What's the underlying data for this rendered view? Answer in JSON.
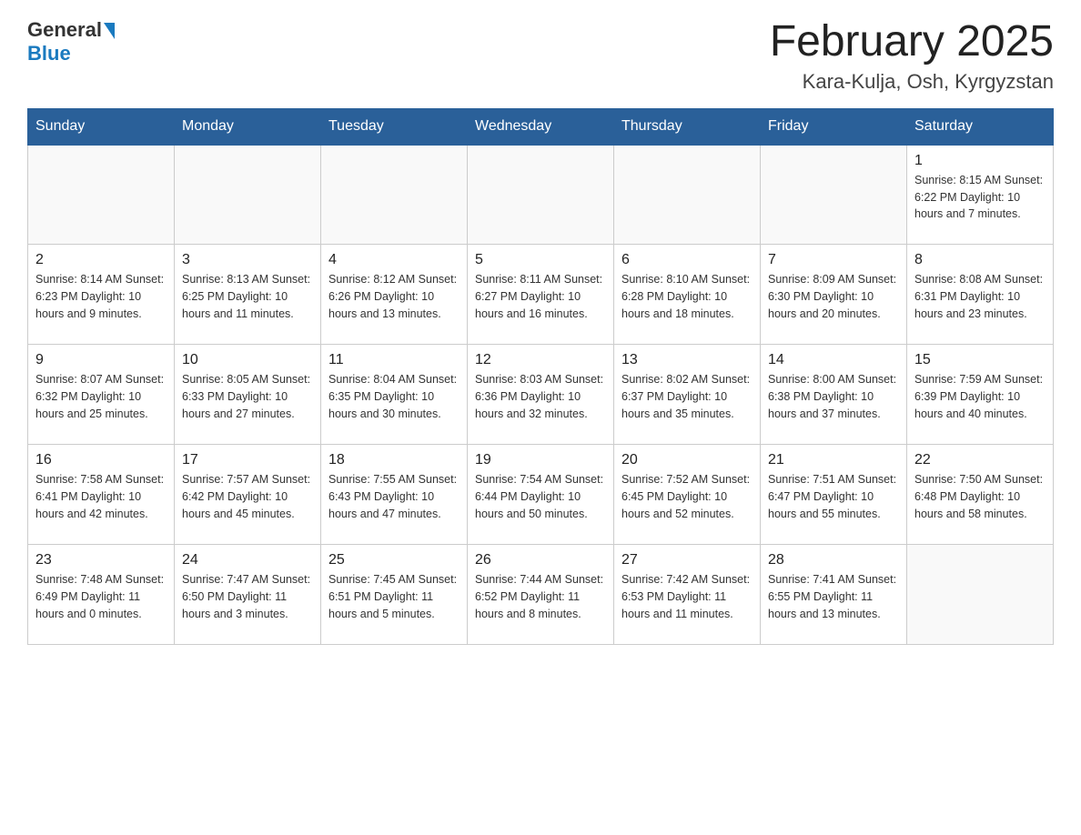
{
  "header": {
    "logo_general": "General",
    "logo_blue": "Blue",
    "title": "February 2025",
    "subtitle": "Kara-Kulja, Osh, Kyrgyzstan"
  },
  "days_of_week": [
    "Sunday",
    "Monday",
    "Tuesday",
    "Wednesday",
    "Thursday",
    "Friday",
    "Saturday"
  ],
  "weeks": [
    [
      {
        "day": "",
        "info": ""
      },
      {
        "day": "",
        "info": ""
      },
      {
        "day": "",
        "info": ""
      },
      {
        "day": "",
        "info": ""
      },
      {
        "day": "",
        "info": ""
      },
      {
        "day": "",
        "info": ""
      },
      {
        "day": "1",
        "info": "Sunrise: 8:15 AM\nSunset: 6:22 PM\nDaylight: 10 hours and 7 minutes."
      }
    ],
    [
      {
        "day": "2",
        "info": "Sunrise: 8:14 AM\nSunset: 6:23 PM\nDaylight: 10 hours and 9 minutes."
      },
      {
        "day": "3",
        "info": "Sunrise: 8:13 AM\nSunset: 6:25 PM\nDaylight: 10 hours and 11 minutes."
      },
      {
        "day": "4",
        "info": "Sunrise: 8:12 AM\nSunset: 6:26 PM\nDaylight: 10 hours and 13 minutes."
      },
      {
        "day": "5",
        "info": "Sunrise: 8:11 AM\nSunset: 6:27 PM\nDaylight: 10 hours and 16 minutes."
      },
      {
        "day": "6",
        "info": "Sunrise: 8:10 AM\nSunset: 6:28 PM\nDaylight: 10 hours and 18 minutes."
      },
      {
        "day": "7",
        "info": "Sunrise: 8:09 AM\nSunset: 6:30 PM\nDaylight: 10 hours and 20 minutes."
      },
      {
        "day": "8",
        "info": "Sunrise: 8:08 AM\nSunset: 6:31 PM\nDaylight: 10 hours and 23 minutes."
      }
    ],
    [
      {
        "day": "9",
        "info": "Sunrise: 8:07 AM\nSunset: 6:32 PM\nDaylight: 10 hours and 25 minutes."
      },
      {
        "day": "10",
        "info": "Sunrise: 8:05 AM\nSunset: 6:33 PM\nDaylight: 10 hours and 27 minutes."
      },
      {
        "day": "11",
        "info": "Sunrise: 8:04 AM\nSunset: 6:35 PM\nDaylight: 10 hours and 30 minutes."
      },
      {
        "day": "12",
        "info": "Sunrise: 8:03 AM\nSunset: 6:36 PM\nDaylight: 10 hours and 32 minutes."
      },
      {
        "day": "13",
        "info": "Sunrise: 8:02 AM\nSunset: 6:37 PM\nDaylight: 10 hours and 35 minutes."
      },
      {
        "day": "14",
        "info": "Sunrise: 8:00 AM\nSunset: 6:38 PM\nDaylight: 10 hours and 37 minutes."
      },
      {
        "day": "15",
        "info": "Sunrise: 7:59 AM\nSunset: 6:39 PM\nDaylight: 10 hours and 40 minutes."
      }
    ],
    [
      {
        "day": "16",
        "info": "Sunrise: 7:58 AM\nSunset: 6:41 PM\nDaylight: 10 hours and 42 minutes."
      },
      {
        "day": "17",
        "info": "Sunrise: 7:57 AM\nSunset: 6:42 PM\nDaylight: 10 hours and 45 minutes."
      },
      {
        "day": "18",
        "info": "Sunrise: 7:55 AM\nSunset: 6:43 PM\nDaylight: 10 hours and 47 minutes."
      },
      {
        "day": "19",
        "info": "Sunrise: 7:54 AM\nSunset: 6:44 PM\nDaylight: 10 hours and 50 minutes."
      },
      {
        "day": "20",
        "info": "Sunrise: 7:52 AM\nSunset: 6:45 PM\nDaylight: 10 hours and 52 minutes."
      },
      {
        "day": "21",
        "info": "Sunrise: 7:51 AM\nSunset: 6:47 PM\nDaylight: 10 hours and 55 minutes."
      },
      {
        "day": "22",
        "info": "Sunrise: 7:50 AM\nSunset: 6:48 PM\nDaylight: 10 hours and 58 minutes."
      }
    ],
    [
      {
        "day": "23",
        "info": "Sunrise: 7:48 AM\nSunset: 6:49 PM\nDaylight: 11 hours and 0 minutes."
      },
      {
        "day": "24",
        "info": "Sunrise: 7:47 AM\nSunset: 6:50 PM\nDaylight: 11 hours and 3 minutes."
      },
      {
        "day": "25",
        "info": "Sunrise: 7:45 AM\nSunset: 6:51 PM\nDaylight: 11 hours and 5 minutes."
      },
      {
        "day": "26",
        "info": "Sunrise: 7:44 AM\nSunset: 6:52 PM\nDaylight: 11 hours and 8 minutes."
      },
      {
        "day": "27",
        "info": "Sunrise: 7:42 AM\nSunset: 6:53 PM\nDaylight: 11 hours and 11 minutes."
      },
      {
        "day": "28",
        "info": "Sunrise: 7:41 AM\nSunset: 6:55 PM\nDaylight: 11 hours and 13 minutes."
      },
      {
        "day": "",
        "info": ""
      }
    ]
  ]
}
